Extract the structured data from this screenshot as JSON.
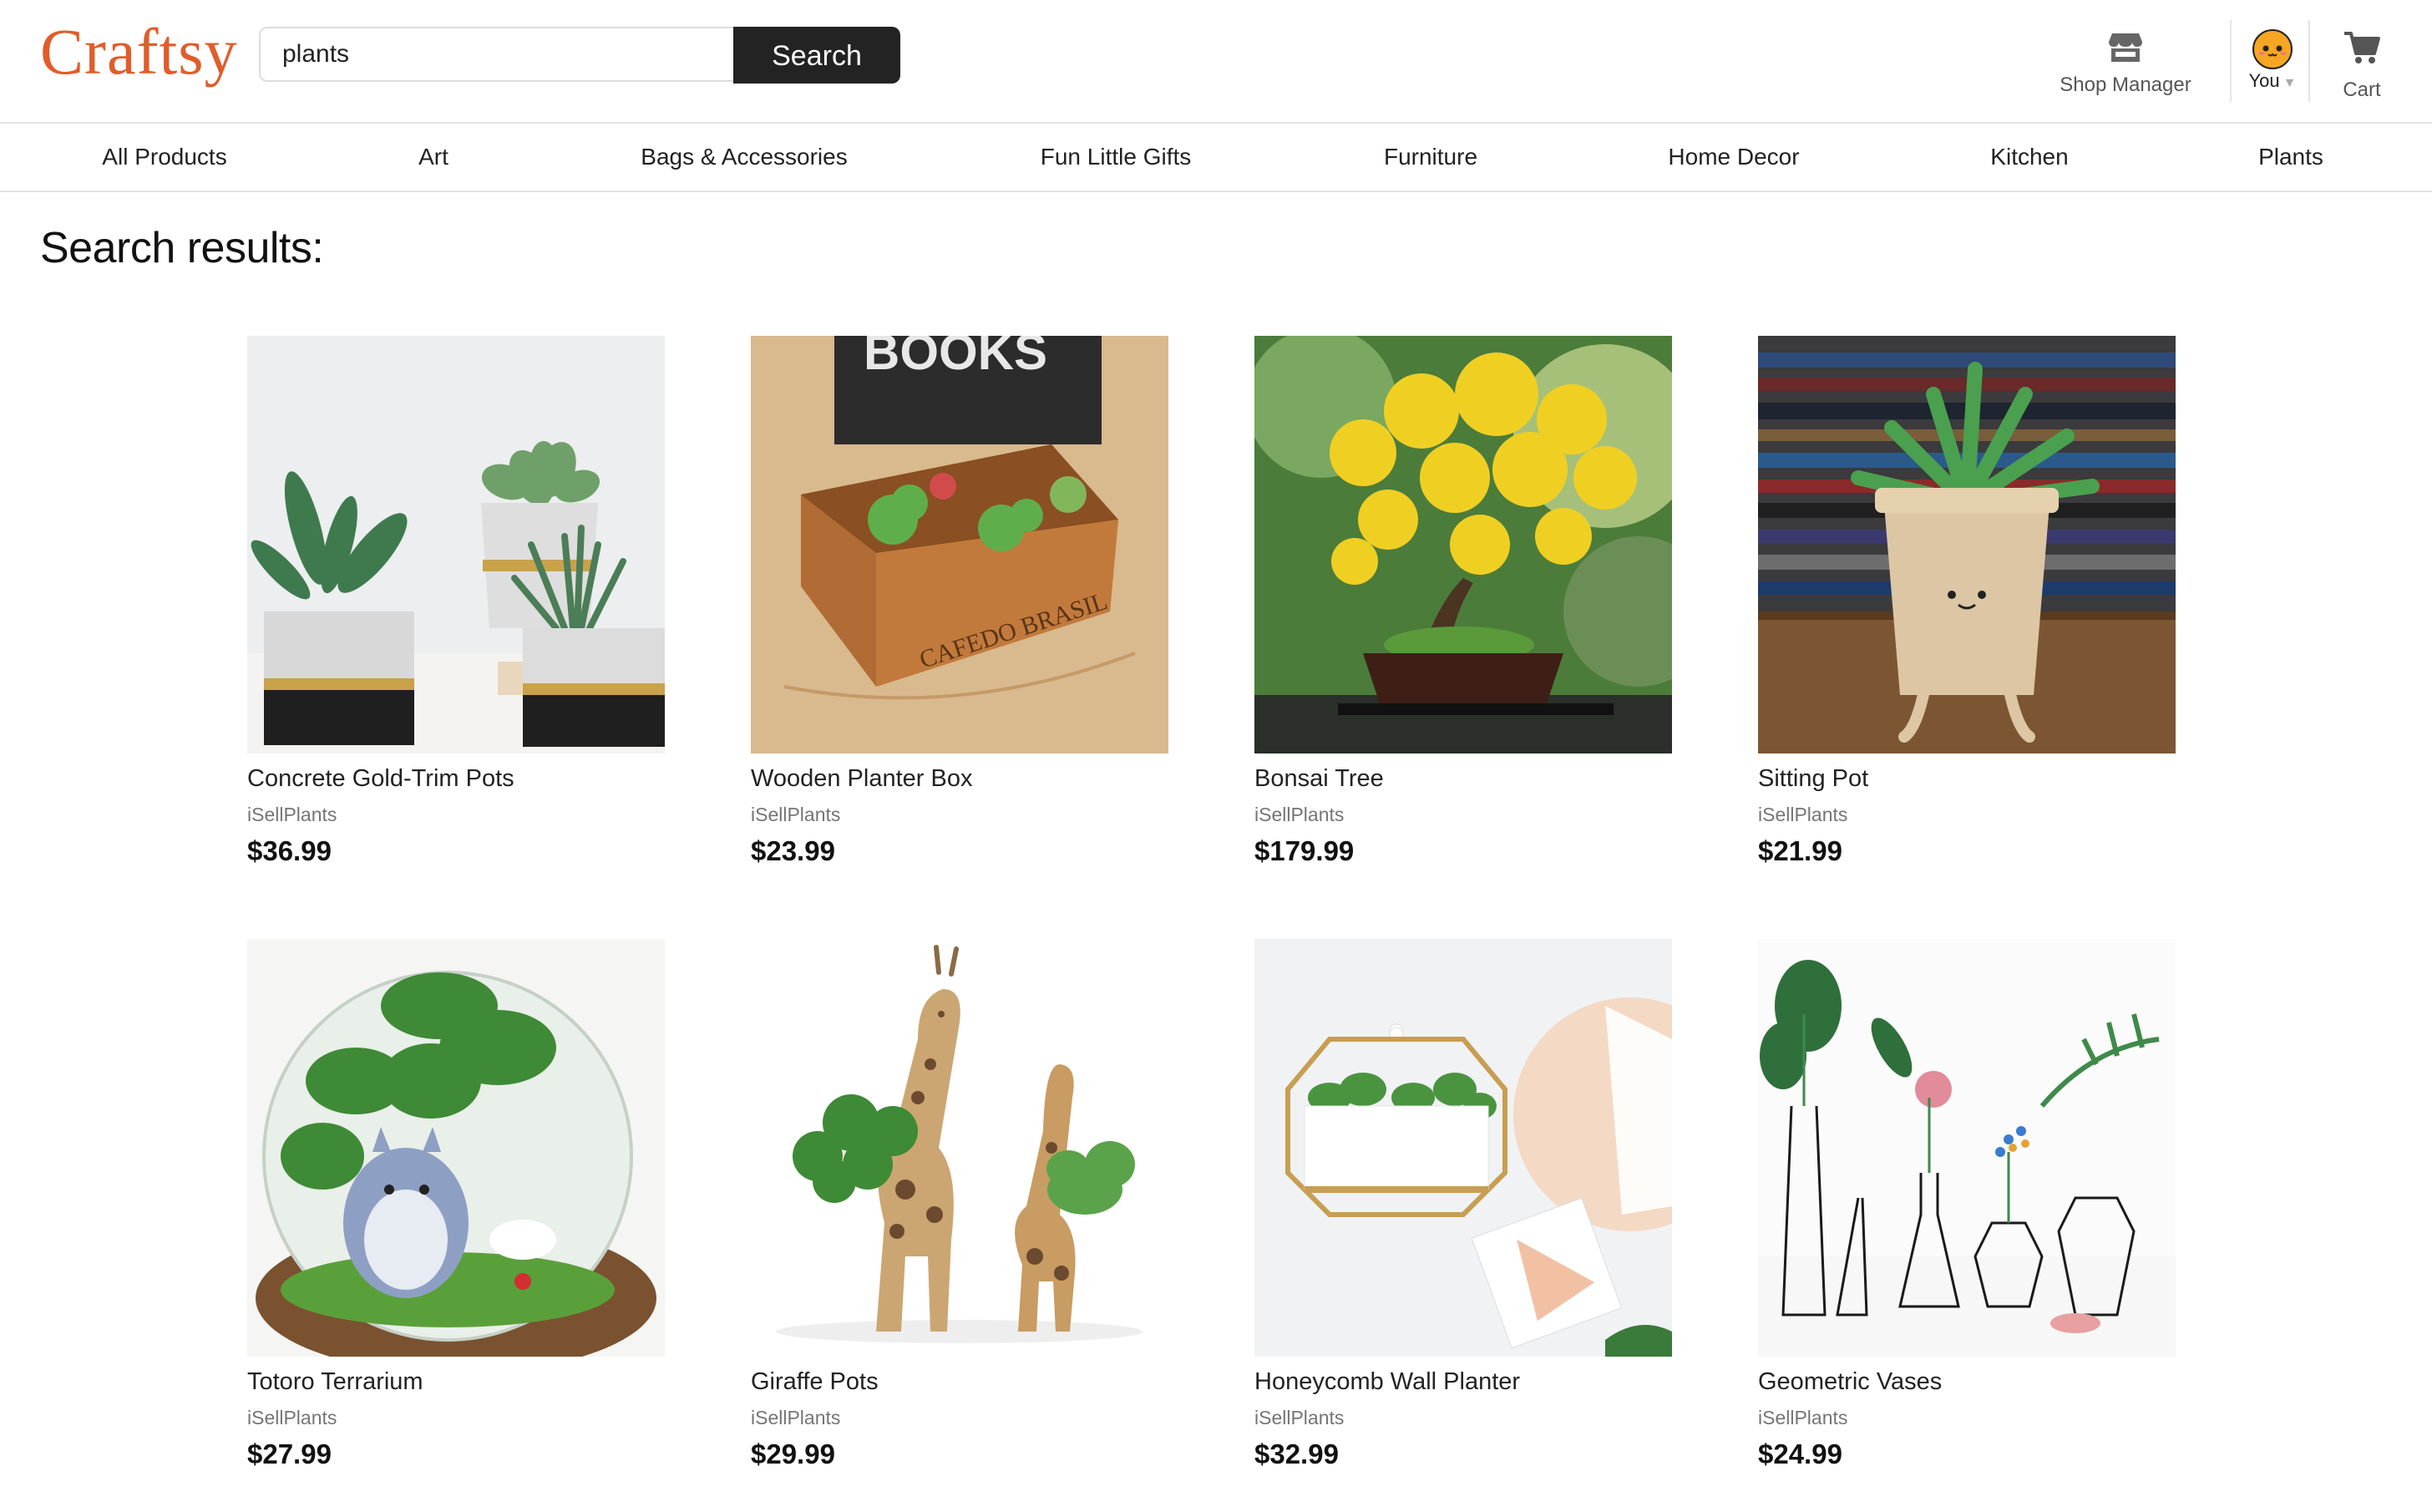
{
  "header": {
    "logo": "Craftsy",
    "search": {
      "value": "plants"
    },
    "search_button": "Search",
    "shop_manager": {
      "label": "Shop Manager",
      "icon": "shop-icon"
    },
    "user": {
      "label": "You",
      "caret": "▼",
      "icon": "avatar-icon"
    },
    "cart": {
      "label": "Cart",
      "icon": "cart-icon"
    },
    "accent_color": "#e05d2b"
  },
  "nav": {
    "items": [
      {
        "label": "All Products"
      },
      {
        "label": "Art"
      },
      {
        "label": "Bags & Accessories"
      },
      {
        "label": "Fun Little Gifts"
      },
      {
        "label": "Furniture"
      },
      {
        "label": "Home Decor"
      },
      {
        "label": "Kitchen"
      },
      {
        "label": "Plants"
      }
    ]
  },
  "main": {
    "title": "Search results:",
    "products": [
      {
        "name": "Concrete Gold-Trim Pots",
        "seller": "iSellPlants",
        "price": "$36.99"
      },
      {
        "name": "Wooden Planter Box",
        "seller": "iSellPlants",
        "price": "$23.99",
        "image_text": {
          "sign": "BOOKS",
          "box": "CAFEDO BRASIL"
        }
      },
      {
        "name": "Bonsai Tree",
        "seller": "iSellPlants",
        "price": "$179.99"
      },
      {
        "name": "Sitting Pot",
        "seller": "iSellPlants",
        "price": "$21.99"
      },
      {
        "name": "Totoro Terrarium",
        "seller": "iSellPlants",
        "price": "$27.99"
      },
      {
        "name": "Giraffe Pots",
        "seller": "iSellPlants",
        "price": "$29.99"
      },
      {
        "name": "Honeycomb Wall Planter",
        "seller": "iSellPlants",
        "price": "$32.99"
      },
      {
        "name": "Geometric Vases",
        "seller": "iSellPlants",
        "price": "$24.99"
      }
    ]
  }
}
